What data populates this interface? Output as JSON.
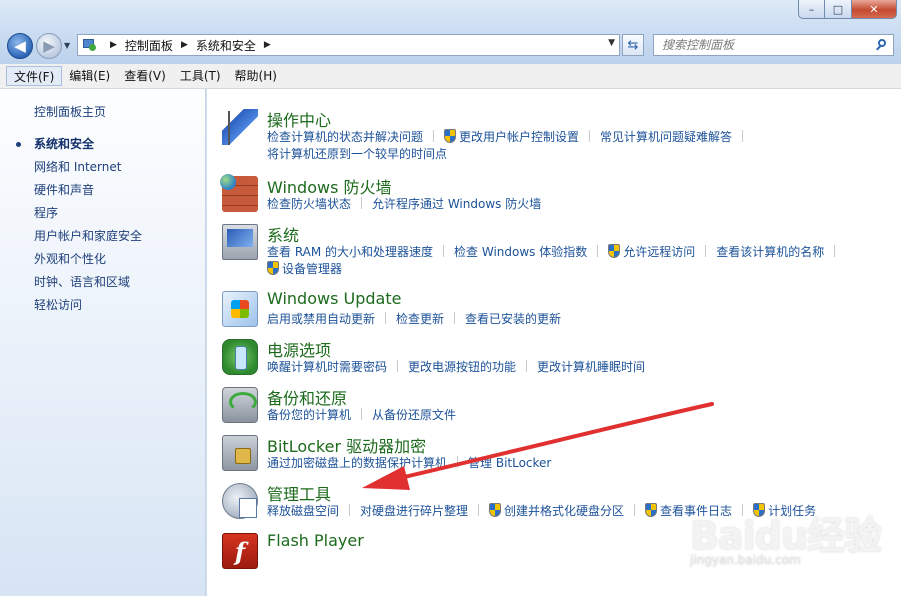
{
  "window": {
    "minimize_label": "–",
    "maximize_label": "□",
    "close_label": "✕"
  },
  "address": {
    "crumbs": [
      "控制面板",
      "系统和安全"
    ],
    "separator": "▶",
    "search_placeholder": "搜索控制面板"
  },
  "menu": [
    "文件(F)",
    "编辑(E)",
    "查看(V)",
    "工具(T)",
    "帮助(H)"
  ],
  "sidebar": {
    "home": "控制面板主页",
    "items": [
      "系统和安全",
      "网络和 Internet",
      "硬件和声音",
      "程序",
      "用户帐户和家庭安全",
      "外观和个性化",
      "时钟、语言和区域",
      "轻松访问"
    ]
  },
  "categories": [
    {
      "icon": "action-center-flag-icon",
      "title": "操作中心",
      "links": [
        "检查计算机的状态并解决问题",
        "更改用户帐户控制设置",
        "常见计算机问题疑难解答",
        "将计算机还原到一个较早的时间点"
      ]
    },
    {
      "icon": "firewall-icon",
      "title": "Windows 防火墙",
      "links": [
        "检查防火墙状态",
        "允许程序通过 Windows 防火墙"
      ]
    },
    {
      "icon": "system-icon",
      "title": "系统",
      "links": [
        "查看 RAM 的大小和处理器速度",
        "检查 Windows 体验指数",
        "允许远程访问",
        "查看该计算机的名称",
        "设备管理器"
      ]
    },
    {
      "icon": "windows-update-icon",
      "title": "Windows Update",
      "links": [
        "启用或禁用自动更新",
        "检查更新",
        "查看已安装的更新"
      ]
    },
    {
      "icon": "power-options-icon",
      "title": "电源选项",
      "links": [
        "唤醒计算机时需要密码",
        "更改电源按钮的功能",
        "更改计算机睡眠时间"
      ]
    },
    {
      "icon": "backup-restore-icon",
      "title": "备份和还原",
      "links": [
        "备份您的计算机",
        "从备份还原文件"
      ]
    },
    {
      "icon": "bitlocker-icon",
      "title": "BitLocker 驱动器加密",
      "links": [
        "通过加密磁盘上的数据保护计算机",
        "管理 BitLocker"
      ]
    },
    {
      "icon": "admin-tools-icon",
      "title": "管理工具",
      "links": [
        "释放磁盘空间",
        "对硬盘进行碎片整理",
        "创建并格式化硬盘分区",
        "查看事件日志",
        "计划任务"
      ]
    },
    {
      "icon": "flash-player-icon",
      "title": "Flash Player",
      "links": []
    }
  ],
  "watermark": {
    "brand": "Baidu经验",
    "sub": "jingyan.baidu.com"
  },
  "colors": {
    "title_green": "#1c6a1c",
    "link_blue": "#1c5299",
    "annotation_red": "#e03030"
  }
}
